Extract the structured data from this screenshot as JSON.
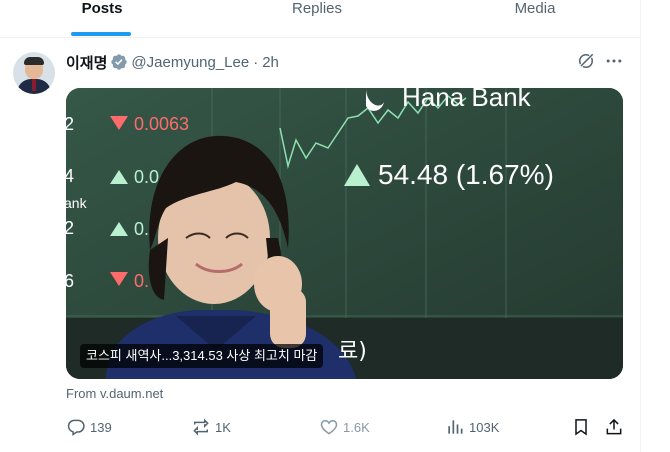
{
  "tabs": [
    {
      "label": "Posts",
      "active": true
    },
    {
      "label": "Replies",
      "active": false
    },
    {
      "label": "Media",
      "active": false
    }
  ],
  "post": {
    "author_name": "이재명",
    "handle": "@Jaemyung_Lee",
    "separator": "·",
    "time": "2h",
    "card": {
      "caption": "코스피 새역사...3,314.53 사상 최고치 마감",
      "board": {
        "bank_text": "Hana Bank",
        "main_change": "54.48 (1.67%)",
        "row1_value": "0.0063",
        "row2_value": "0.0",
        "row3_value": "0.",
        "row4_value": "0.",
        "left_digits": [
          "2",
          "4",
          "ank",
          "2",
          "6"
        ],
        "overlay_text": "료)"
      }
    },
    "source": "From v.daum.net",
    "stats": {
      "replies": "139",
      "reposts": "1K",
      "likes": "1.6K",
      "views": "103K"
    }
  },
  "colors": {
    "accent": "#1d9bf0",
    "text_primary": "#0f1419",
    "text_secondary": "#536471",
    "board_green": "#2c4a3c",
    "up_arrow": "#b8f0d0",
    "down_arrow": "#ff6b6b"
  },
  "icons": {
    "verified": "verified-badge-icon",
    "grok": "grok-icon",
    "more": "more-icon",
    "reply": "reply-icon",
    "repost": "repost-icon",
    "like": "heart-icon",
    "views": "views-icon",
    "bookmark": "bookmark-icon",
    "share": "share-icon"
  }
}
